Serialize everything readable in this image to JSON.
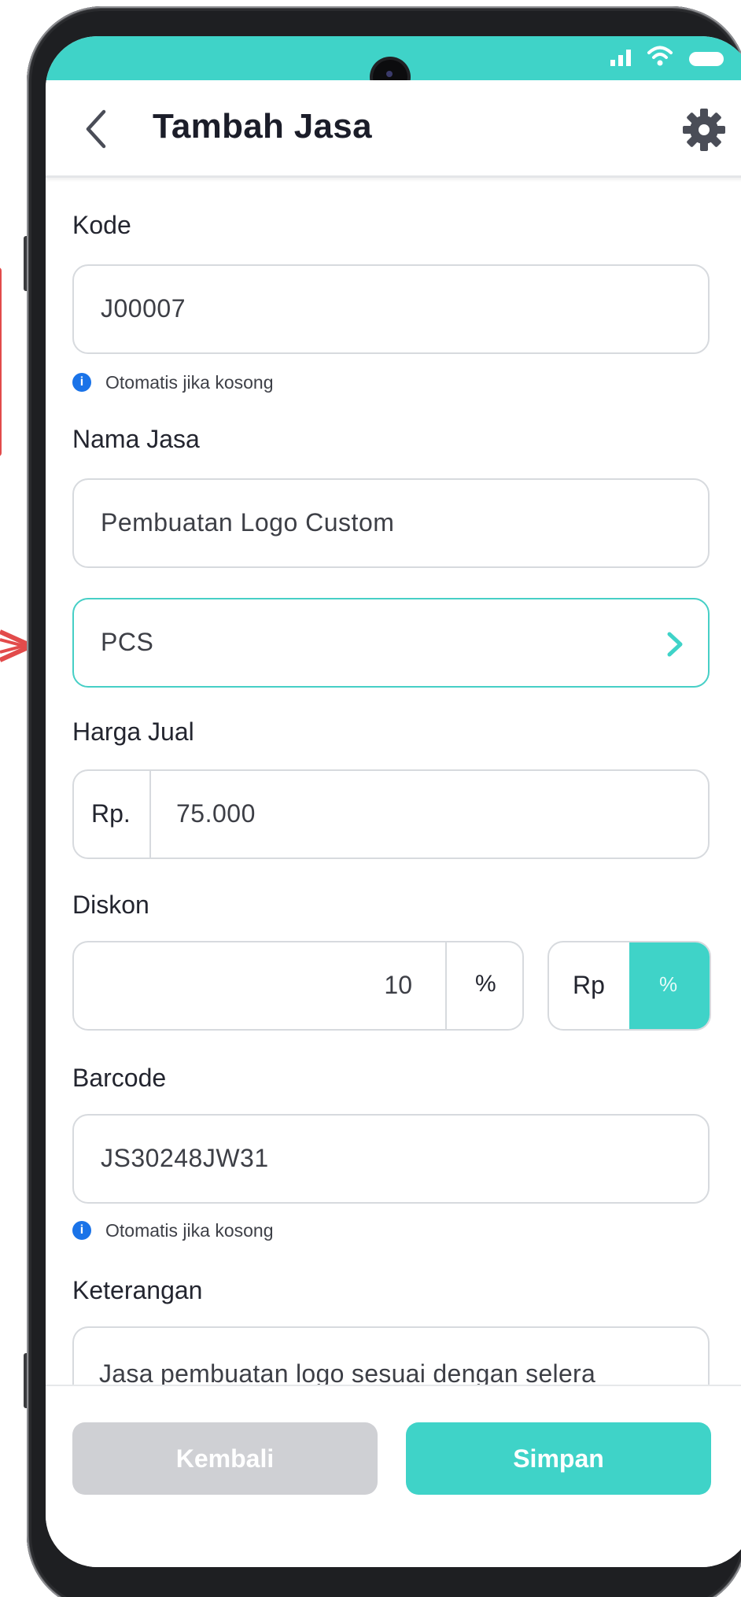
{
  "status_bar": {
    "signal_icon": "signal-icon",
    "wifi_icon": "wifi-icon",
    "battery_icon": "battery-icon"
  },
  "header": {
    "title": "Tambah Jasa",
    "back_icon": "back-arrow-icon",
    "settings_icon": "gear-icon"
  },
  "form": {
    "kode": {
      "label": "Kode",
      "value": "J00007",
      "hint": "Otomatis jika kosong"
    },
    "nama_jasa": {
      "label": "Nama Jasa",
      "value": "Pembuatan Logo Custom"
    },
    "satuan": {
      "value": "PCS"
    },
    "harga_jual": {
      "label": "Harga Jual",
      "prefix": "Rp.",
      "value": "75.000"
    },
    "diskon": {
      "label": "Diskon",
      "value": "10",
      "unit": "%",
      "toggle_options": [
        "Rp",
        "%"
      ],
      "selected": "%"
    },
    "barcode": {
      "label": "Barcode",
      "value": "JS30248JW31",
      "hint": "Otomatis jika kosong"
    },
    "keterangan": {
      "label": "Keterangan",
      "value": "Jasa pembuatan logo sesuai dengan selera"
    }
  },
  "actions": {
    "back_label": "Kembali",
    "save_label": "Simpan"
  },
  "colors": {
    "accent": "#3fd3c8",
    "disabled": "#cfd0d4",
    "info": "#1a73e8"
  }
}
